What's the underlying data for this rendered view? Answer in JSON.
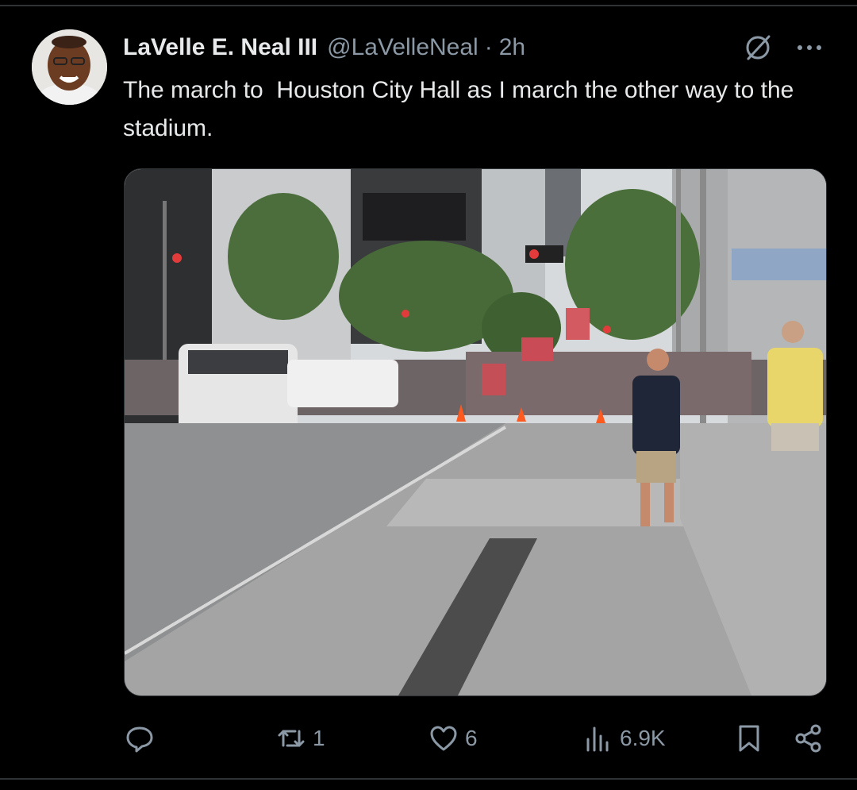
{
  "tweet": {
    "author": {
      "display_name": "LaVelle E. Neal III",
      "handle": "@LaVelleNeal",
      "separator": "·",
      "time": "2h"
    },
    "text": "The march to  Houston City Hall as I march the other way to the stadium.",
    "media": {
      "type": "photo",
      "icons": [
        "street-scene"
      ]
    },
    "actions": {
      "reply": {
        "icon": "reply-icon",
        "count": ""
      },
      "repost": {
        "icon": "repost-icon",
        "count": "1"
      },
      "like": {
        "icon": "heart-icon",
        "count": "6"
      },
      "views": {
        "icon": "views-icon",
        "count": "6.9K"
      },
      "bookmark": {
        "icon": "bookmark-icon"
      },
      "share": {
        "icon": "share-icon"
      }
    }
  },
  "colors": {
    "background": "#000000",
    "text_primary": "#e7e9ea",
    "text_secondary": "#8b98a5",
    "divider": "#2f3336"
  }
}
